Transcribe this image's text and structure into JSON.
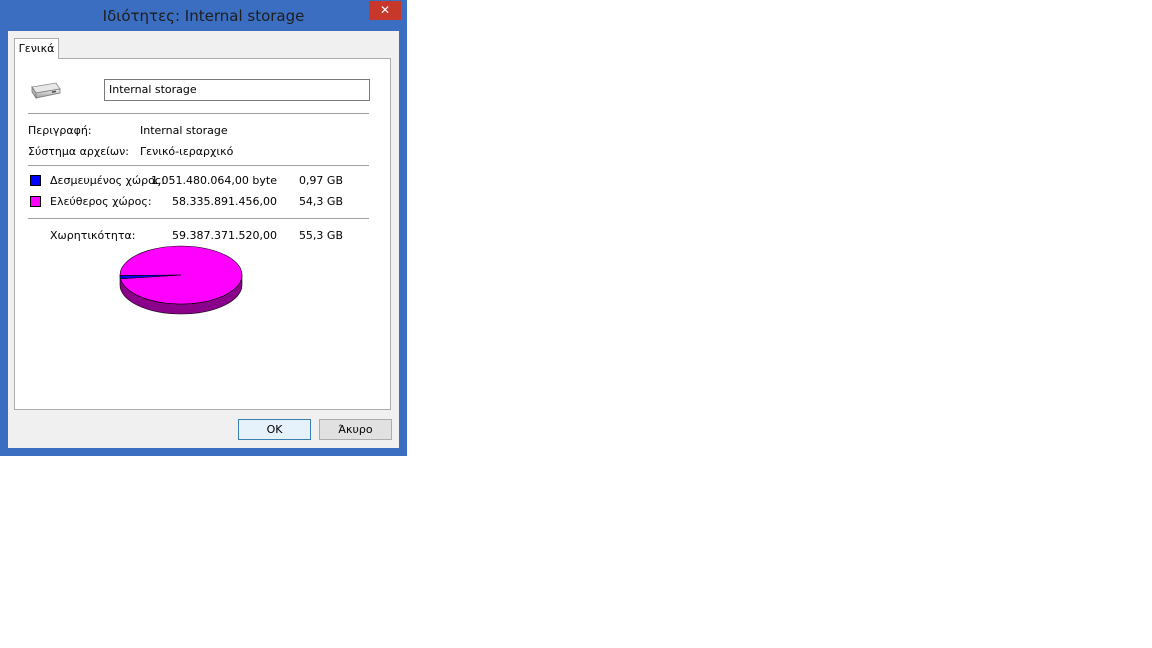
{
  "window": {
    "title": "Ιδιότητες: Internal storage",
    "close_glyph": "✕"
  },
  "tabs": [
    {
      "label": "Γενικά",
      "active": true
    }
  ],
  "general": {
    "name_value": "Internal storage",
    "description_label": "Περιγραφή:",
    "description_value": "Internal storage",
    "filesystem_label": "Σύστημα αρχείων:",
    "filesystem_value": "Γενικό-ιεραρχικό"
  },
  "usage": {
    "used_label": "Δεσμευμένος χώρος:",
    "used_bytes": "1.051.480.064,00 byte",
    "used_size": "0,97 GB",
    "used_color": "#0000ff",
    "free_label": "Ελεύθερος χώρος:",
    "free_bytes": "58.335.891.456,00",
    "free_size": "54,3 GB",
    "free_color": "#ff00ff",
    "capacity_label": "Χωρητικότητα:",
    "capacity_bytes": "59.387.371.520,00",
    "capacity_size": "55,3 GB",
    "used_fraction": 0.0177
  },
  "buttons": {
    "ok": "OK",
    "cancel": "Άκυρο"
  }
}
